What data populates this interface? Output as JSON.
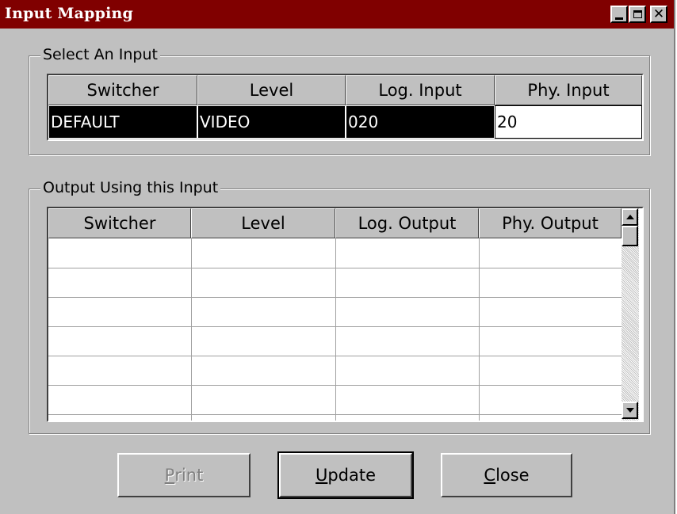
{
  "window": {
    "title": "Input Mapping",
    "controls": {
      "minimize": "minimize",
      "maximize": "maximize",
      "close": "close"
    }
  },
  "select_input": {
    "group_label": "Select An Input",
    "headers": [
      "Switcher",
      "Level",
      "Log. Input",
      "Phy. Input"
    ],
    "row": [
      "DEFAULT",
      "VIDEO",
      "020",
      "20"
    ]
  },
  "output_using": {
    "group_label": "Output Using this Input",
    "headers": [
      "Switcher",
      "Level",
      "Log. Output",
      "Phy. Output"
    ],
    "rows": [
      [
        "",
        "",
        "",
        ""
      ],
      [
        "",
        "",
        "",
        ""
      ],
      [
        "",
        "",
        "",
        ""
      ],
      [
        "",
        "",
        "",
        ""
      ],
      [
        "",
        "",
        "",
        ""
      ],
      [
        "",
        "",
        "",
        ""
      ]
    ]
  },
  "buttons": {
    "print": {
      "mnemonic": "P",
      "rest": "rint",
      "enabled": false
    },
    "update": {
      "mnemonic": "U",
      "rest": "pdate",
      "enabled": true
    },
    "close": {
      "mnemonic": "C",
      "rest": "lose",
      "enabled": true
    }
  },
  "colors": {
    "titlebar": "#800000",
    "face": "#c0c0c0",
    "selected_cell": "#000000"
  },
  "icons": [
    "minimize-icon",
    "maximize-icon",
    "close-icon",
    "scroll-up-arrow-icon",
    "scroll-down-arrow-icon"
  ]
}
